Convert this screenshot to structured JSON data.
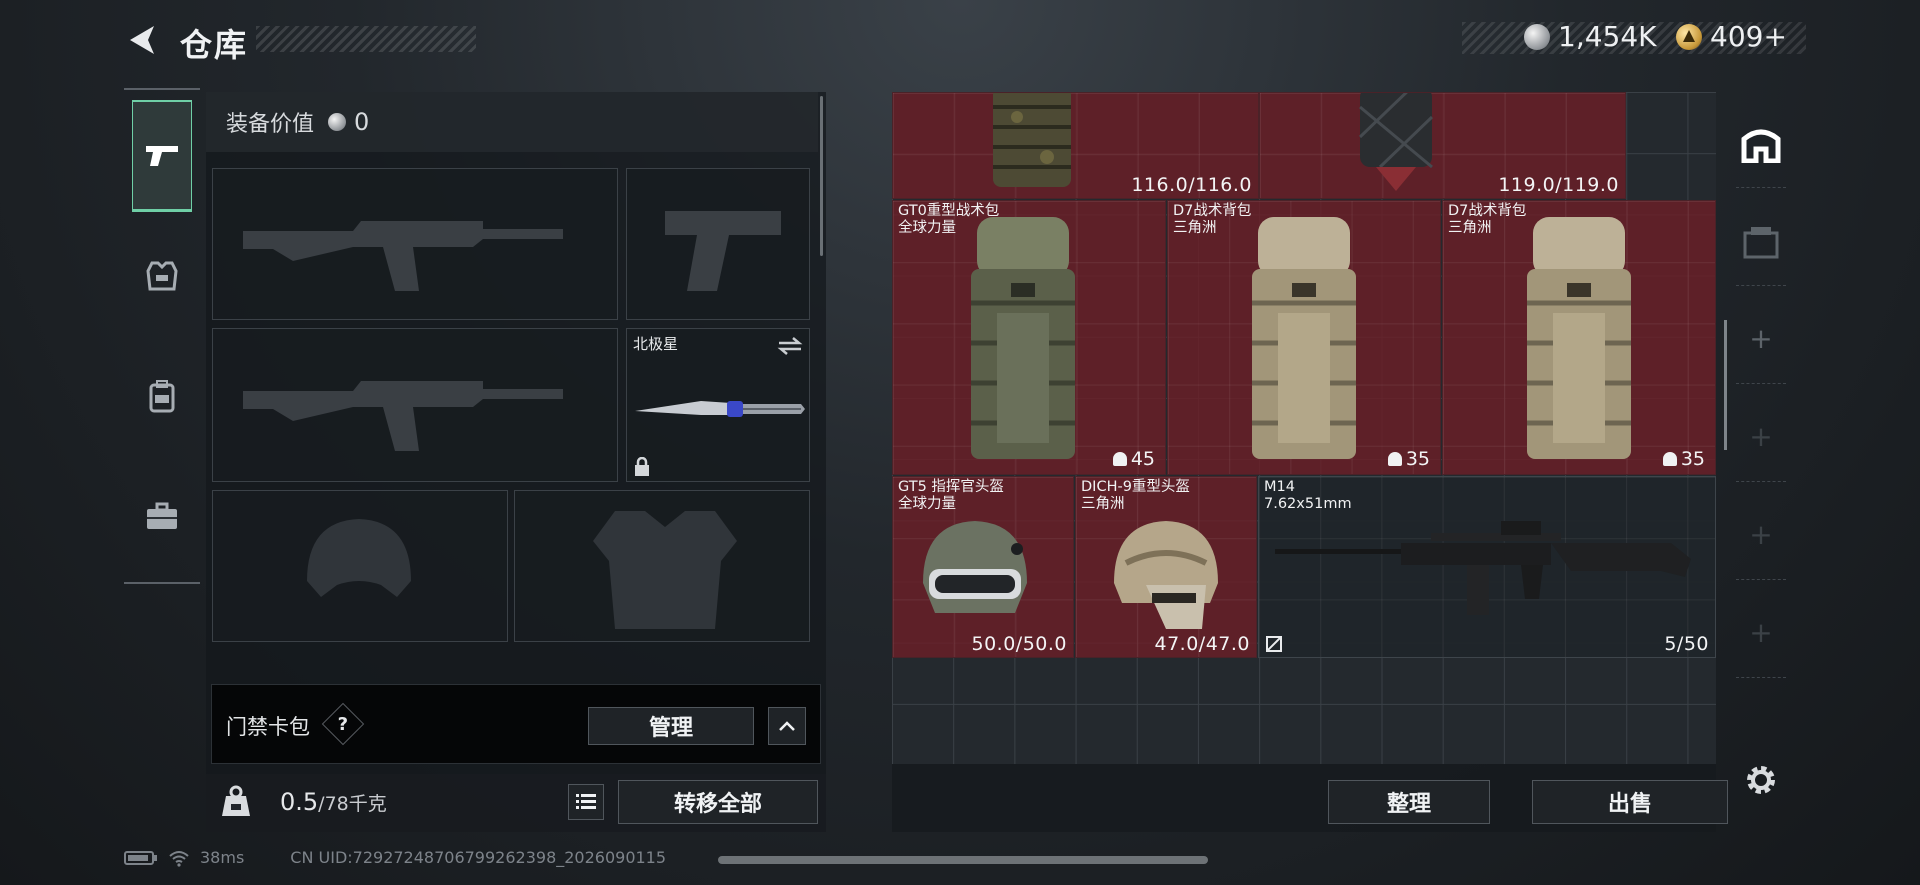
{
  "header": {
    "title": "仓库",
    "currency": [
      {
        "icon": "silver-coin-icon",
        "value": "1,454K"
      },
      {
        "icon": "gold-coin-icon",
        "value": "409+"
      }
    ]
  },
  "side_tabs": [
    {
      "icon": "pistol-icon",
      "active": true
    },
    {
      "icon": "vest-icon",
      "active": false
    },
    {
      "icon": "backpack-icon",
      "active": false
    },
    {
      "icon": "briefcase-icon",
      "active": false
    }
  ],
  "loadout": {
    "equip_value_label": "装备价值",
    "equip_value": "0",
    "melee_slot_label": "北极星",
    "keycard_label": "门禁卡包",
    "keycard_help": "?",
    "manage_label": "管理",
    "weight_value": "0.5",
    "weight_max": "/78千克",
    "transfer_all_label": "转移全部"
  },
  "storage": {
    "items": [
      {
        "id": "top-left",
        "value": "116.0/116.0"
      },
      {
        "id": "top-right",
        "value": "119.0/119.0"
      },
      {
        "id": "gt0",
        "name": "GT0重型战术包",
        "source": "全球力量",
        "capacity": "45"
      },
      {
        "id": "d7a",
        "name": "D7战术背包",
        "source": "三角洲",
        "capacity": "35"
      },
      {
        "id": "d7b",
        "name": "D7战术背包",
        "source": "三角洲",
        "capacity": "35"
      },
      {
        "id": "gt5",
        "name": "GT5 指挥官头盔",
        "source": "全球力量",
        "value": "50.0/50.0"
      },
      {
        "id": "dich9",
        "name": "DICH-9重型头盔",
        "source": "三角洲",
        "value": "47.0/47.0"
      },
      {
        "id": "m14",
        "name": "M14",
        "source": "7.62x51mm",
        "value": "5/50"
      }
    ],
    "sort_label": "整理",
    "sell_label": "出售"
  },
  "status_bar": {
    "ping": "38ms",
    "uid": "CN UID:72927248706799262398_2026090115"
  },
  "colors": {
    "accent": "#6fcfa6",
    "item_red": "#6e1e26"
  }
}
